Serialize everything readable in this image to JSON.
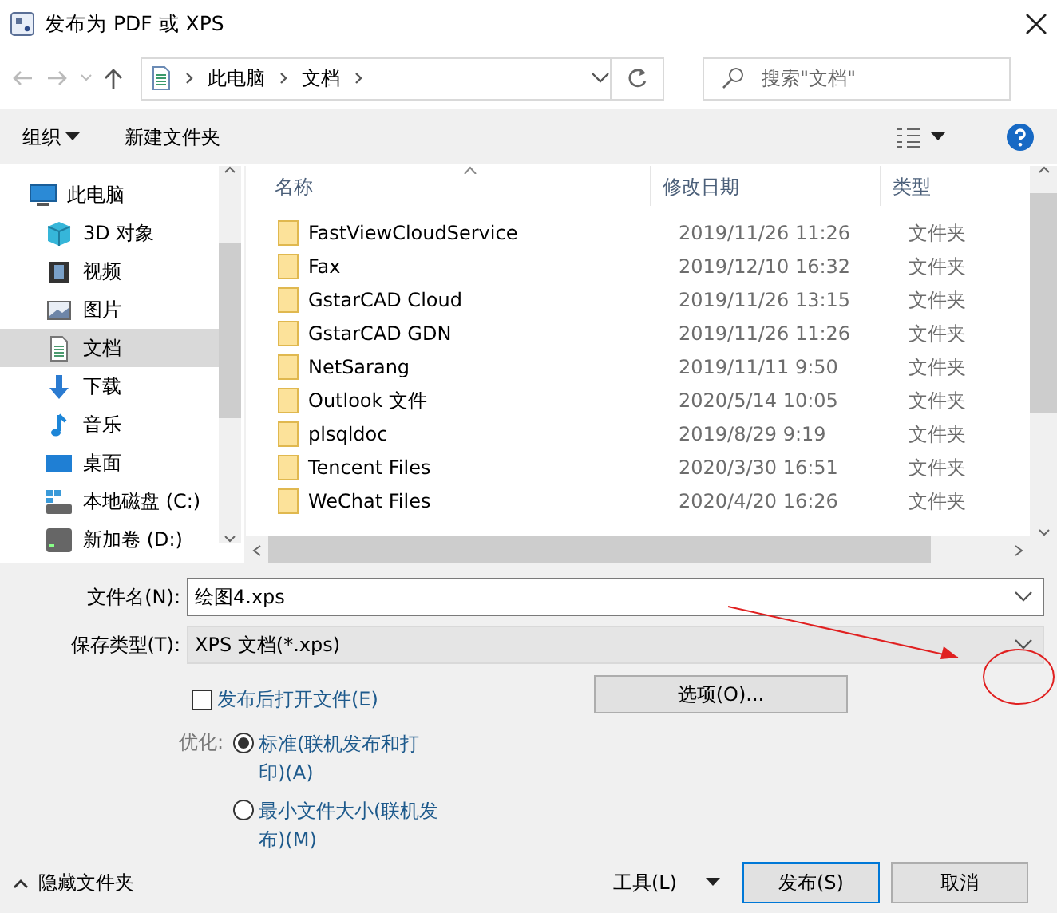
{
  "window": {
    "title": "发布为 PDF 或 XPS"
  },
  "address": {
    "path": [
      "此电脑",
      "文档"
    ]
  },
  "search": {
    "placeholder": "搜索\"文档\""
  },
  "toolbar": {
    "organize": "组织",
    "new_folder": "新建文件夹"
  },
  "sidebar": {
    "items": [
      {
        "label": "此电脑",
        "selected": false,
        "children": [
          {
            "label": "3D 对象",
            "selected": false
          },
          {
            "label": "视频",
            "selected": false
          },
          {
            "label": "图片",
            "selected": false
          },
          {
            "label": "文档",
            "selected": true
          },
          {
            "label": "下载",
            "selected": false
          },
          {
            "label": "音乐",
            "selected": false
          },
          {
            "label": "桌面",
            "selected": false
          },
          {
            "label": "本地磁盘 (C:)",
            "selected": false
          },
          {
            "label": "新加卷 (D:)",
            "selected": false
          }
        ]
      }
    ]
  },
  "table": {
    "columns": [
      "名称",
      "修改日期",
      "类型"
    ],
    "rows": [
      {
        "name": "FastViewCloudService",
        "date": "2019/11/26 11:26",
        "type": "文件夹"
      },
      {
        "name": "Fax",
        "date": "2019/12/10 16:32",
        "type": "文件夹"
      },
      {
        "name": "GstarCAD Cloud",
        "date": "2019/11/26 13:15",
        "type": "文件夹"
      },
      {
        "name": "GstarCAD GDN",
        "date": "2019/11/26 11:26",
        "type": "文件夹"
      },
      {
        "name": "NetSarang",
        "date": "2019/11/11 9:50",
        "type": "文件夹"
      },
      {
        "name": "Outlook 文件",
        "date": "2020/5/14 10:05",
        "type": "文件夹"
      },
      {
        "name": "plsqldoc",
        "date": "2019/8/29 9:19",
        "type": "文件夹"
      },
      {
        "name": "Tencent Files",
        "date": "2020/3/30 16:51",
        "type": "文件夹"
      },
      {
        "name": "WeChat Files",
        "date": "2020/4/20 16:26",
        "type": "文件夹"
      }
    ]
  },
  "file_name": {
    "label": "文件名(N):",
    "value": "绘图4.xps"
  },
  "save_type": {
    "label": "保存类型(T):",
    "value": "XPS 文档(*.xps)"
  },
  "open_after": {
    "label": "发布后打开文件(E)",
    "checked": false
  },
  "options_button": "选项(O)...",
  "optimize": {
    "label": "优化:",
    "options": [
      {
        "label": "标准(联机发布和打印)(A)",
        "selected": true
      },
      {
        "label": "最小文件大小(联机发布)(M)",
        "selected": false
      }
    ]
  },
  "hide_folders": "隐藏文件夹",
  "tools": "工具(L)",
  "buttons": [
    {
      "label": "发布(S)",
      "default": true
    },
    {
      "label": "取消",
      "default": false
    }
  ]
}
